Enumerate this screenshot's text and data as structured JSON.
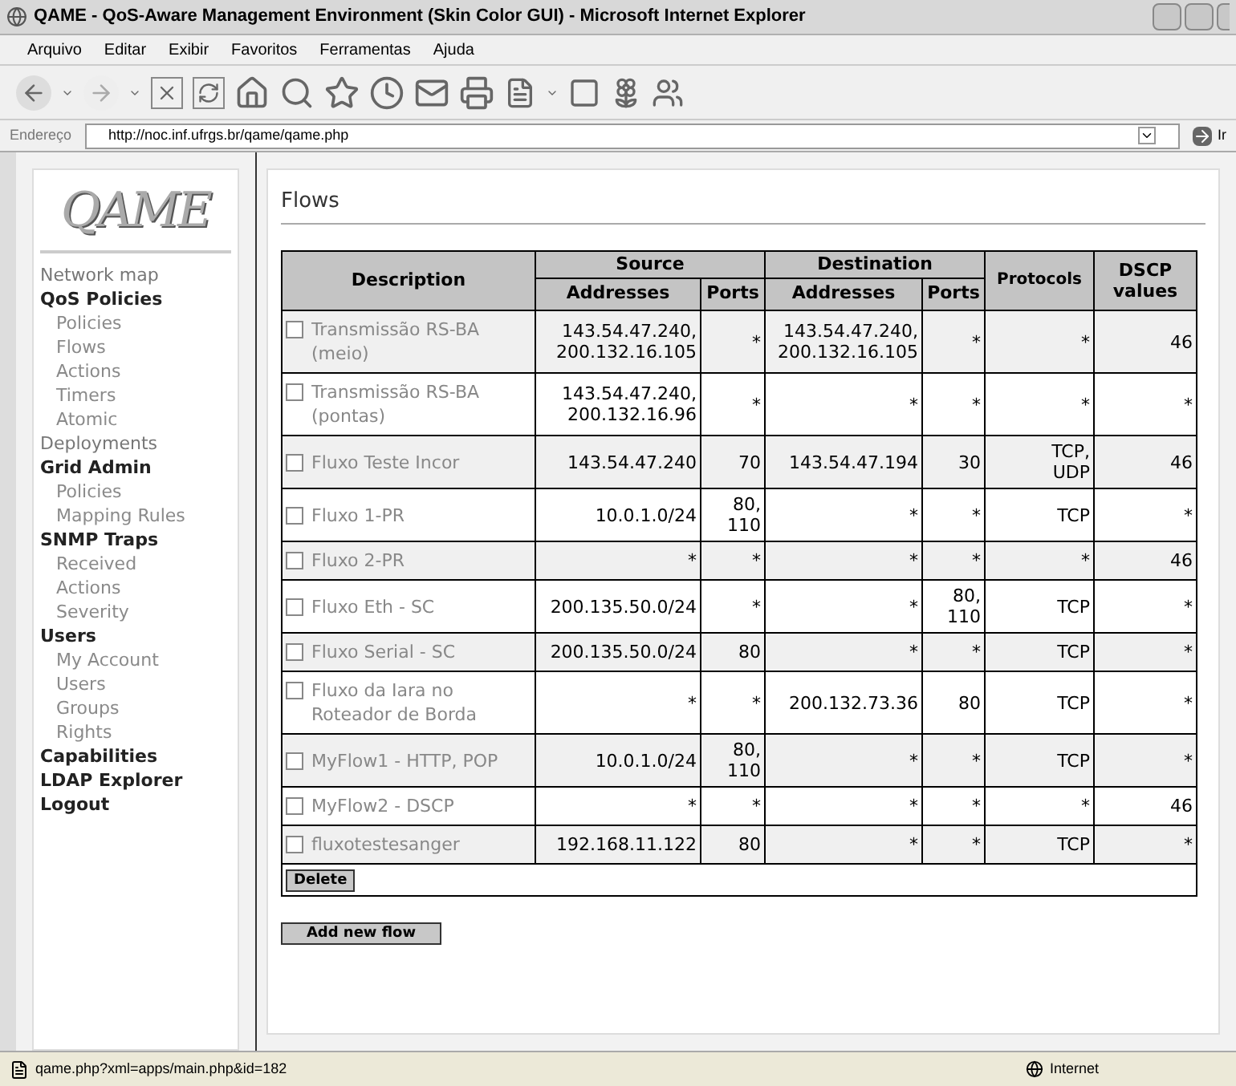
{
  "window": {
    "title": "QAME - QoS-Aware Management Environment (Skin Color GUI) - Microsoft Internet Explorer"
  },
  "menu": [
    "Arquivo",
    "Editar",
    "Exibir",
    "Favoritos",
    "Ferramentas",
    "Ajuda"
  ],
  "address_bar": {
    "label": "Endereço",
    "value": "http://noc.inf.ufrgs.br/qame/qame.php",
    "go": "Ir"
  },
  "sidebar": {
    "logo": "QAME",
    "items": [
      {
        "label": "Network map",
        "kind": "link"
      },
      {
        "label": "QoS Policies",
        "kind": "heading",
        "children": [
          {
            "label": "Policies"
          },
          {
            "label": "Flows"
          },
          {
            "label": "Actions"
          },
          {
            "label": "Timers"
          },
          {
            "label": "Atomic"
          }
        ]
      },
      {
        "label": "Deployments",
        "kind": "link"
      },
      {
        "label": "Grid Admin",
        "kind": "heading",
        "children": [
          {
            "label": "Policies"
          },
          {
            "label": "Mapping Rules"
          }
        ]
      },
      {
        "label": "SNMP Traps",
        "kind": "heading",
        "children": [
          {
            "label": "Received"
          },
          {
            "label": "Actions"
          },
          {
            "label": "Severity"
          }
        ]
      },
      {
        "label": "Users",
        "kind": "heading",
        "children": [
          {
            "label": "My Account"
          },
          {
            "label": "Users"
          },
          {
            "label": "Groups"
          },
          {
            "label": "Rights"
          }
        ]
      },
      {
        "label": "Capabilities",
        "kind": "heading"
      },
      {
        "label": "LDAP Explorer",
        "kind": "heading"
      },
      {
        "label": "Logout",
        "kind": "heading"
      }
    ]
  },
  "page": {
    "title": "Flows"
  },
  "table": {
    "header_groups": {
      "description": "Description",
      "source": "Source",
      "destination": "Destination",
      "protocols": "Protocols",
      "dscp": "DSCP values"
    },
    "sub_columns": [
      "Addresses",
      "Ports",
      "Addresses",
      "Ports"
    ],
    "rows": [
      {
        "description": "Transmissão RS-BA (meio)",
        "checked": false,
        "cells": [
          "143.54.47.240, 200.132.16.105",
          "*",
          "143.54.47.240, 200.132.16.105",
          "*",
          "*",
          "46"
        ]
      },
      {
        "description": "Transmissão RS-BA (pontas)",
        "checked": false,
        "cells": [
          "143.54.47.240, 200.132.16.96",
          "*",
          "*",
          "*",
          "*",
          "*"
        ]
      },
      {
        "description": "Fluxo Teste Incor",
        "checked": false,
        "cells": [
          "143.54.47.240",
          "70",
          "143.54.47.194",
          "30",
          "TCP, UDP",
          "46"
        ]
      },
      {
        "description": "Fluxo 1-PR",
        "checked": false,
        "cells": [
          "10.0.1.0/24",
          "80, 110",
          "*",
          "*",
          "TCP",
          "*"
        ]
      },
      {
        "description": "Fluxo 2-PR",
        "checked": false,
        "cells": [
          "*",
          "*",
          "*",
          "*",
          "*",
          "46"
        ]
      },
      {
        "description": "Fluxo Eth - SC",
        "checked": false,
        "cells": [
          "200.135.50.0/24",
          "*",
          "*",
          "80, 110",
          "TCP",
          "*"
        ]
      },
      {
        "description": "Fluxo Serial - SC",
        "checked": false,
        "cells": [
          "200.135.50.0/24",
          "80",
          "*",
          "*",
          "TCP",
          "*"
        ]
      },
      {
        "description": "Fluxo da Iara no Roteador de Borda",
        "checked": false,
        "cells": [
          "*",
          "*",
          "200.132.73.36",
          "80",
          "TCP",
          "*"
        ]
      },
      {
        "description": "MyFlow1 - HTTP, POP",
        "checked": false,
        "cells": [
          "10.0.1.0/24",
          "80, 110",
          "*",
          "*",
          "TCP",
          "*"
        ]
      },
      {
        "description": "MyFlow2 - DSCP",
        "checked": false,
        "cells": [
          "*",
          "*",
          "*",
          "*",
          "*",
          "46"
        ]
      },
      {
        "description": "fluxotestesanger",
        "checked": false,
        "cells": [
          "192.168.11.122",
          "80",
          "*",
          "*",
          "TCP",
          "*"
        ]
      }
    ],
    "delete_button": "Delete"
  },
  "add_button": "Add new flow",
  "status_bar": {
    "text": "qame.php?xml=apps/main.php&id=182",
    "zone": "Internet"
  }
}
